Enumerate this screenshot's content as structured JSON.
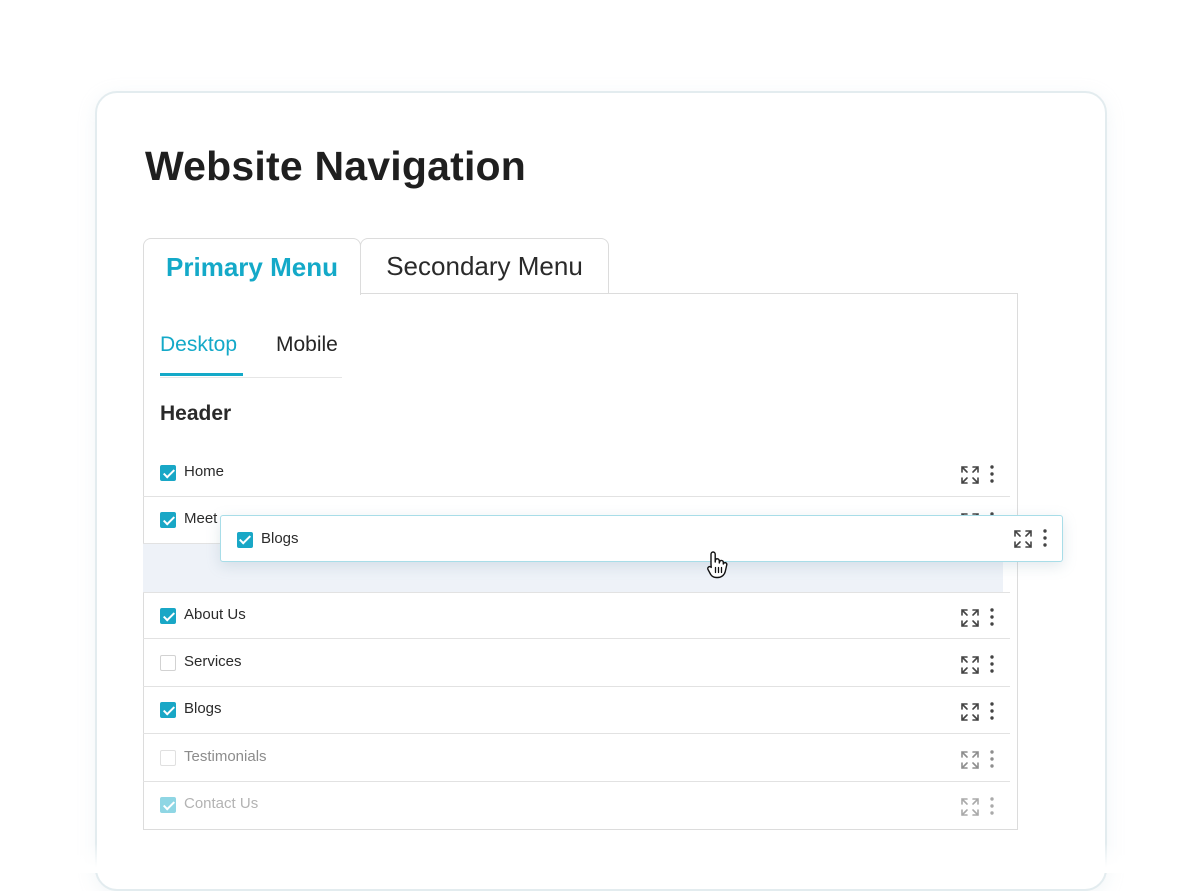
{
  "page": {
    "title": "Website Navigation"
  },
  "menu_tabs": [
    {
      "label": "Primary Menu",
      "active": true
    },
    {
      "label": "Secondary Menu",
      "active": false
    }
  ],
  "device_tabs": [
    {
      "label": "Desktop",
      "active": true
    },
    {
      "label": "Mobile",
      "active": false
    }
  ],
  "section": {
    "title": "Header"
  },
  "menu_items": [
    {
      "label": "Home",
      "checked": true
    },
    {
      "label": "Meet",
      "checked": true
    },
    {
      "label": "About Us",
      "checked": true
    },
    {
      "label": "Services",
      "checked": false
    },
    {
      "label": "Blogs",
      "checked": true
    },
    {
      "label": "Testimonials",
      "checked": false
    },
    {
      "label": "Contact Us",
      "checked": true
    }
  ],
  "dragging_item": {
    "label": "Blogs",
    "checked": true
  },
  "icons": {
    "row_expand": "expand-arrows-icon",
    "row_more": "vertical-dots-icon",
    "cursor": "grab-hand-cursor-icon"
  },
  "colors": {
    "accent": "#14a9c8",
    "checkbox": "#19a7c6",
    "dropzone": "#eef2f8"
  }
}
